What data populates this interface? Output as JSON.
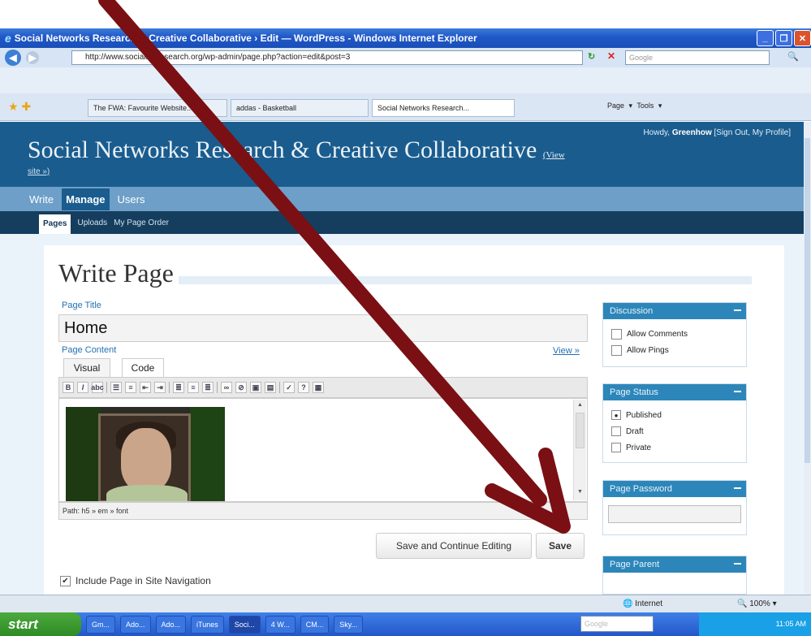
{
  "window": {
    "title": "Social Networks Research & Creative Collaborative › Edit — WordPress - Windows Internet Explorer",
    "url": "http://www.socialnetresearch.org/wp-admin/page.php?action=edit&post=3",
    "search_placeholder": "Google"
  },
  "tabs": [
    {
      "label": "The FWA: Favourite Website..."
    },
    {
      "label": "addas - Basketball"
    },
    {
      "label": "Social Networks Research..."
    }
  ],
  "ie_tools": "Page ▾  Tools ▾",
  "wp": {
    "site_title": "Social Networks Research & Creative Collaborative",
    "view_site_1": "(View",
    "view_site_2": "site »)",
    "howdy_prefix": "Howdy, ",
    "user": "Greenhow",
    "user_links": "[Sign Out, My Profile]",
    "menu": [
      "Write",
      "Manage",
      "Users"
    ],
    "submenu": [
      "Pages",
      "Uploads",
      "My Page Order"
    ]
  },
  "editor": {
    "heading": "Write Page",
    "title_label": "Page Title",
    "title_value": "Home",
    "content_label": "Page Content",
    "view_link": "View »",
    "tab_visual": "Visual",
    "tab_code": "Code",
    "path": "Path: h5 » em » font",
    "btn_continue": "Save and Continue Editing",
    "btn_save": "Save",
    "include_nav": "Include Page in Site Navigation"
  },
  "sidebar": {
    "discussion": {
      "title": "Discussion",
      "options": [
        "Allow Comments",
        "Allow Pings"
      ]
    },
    "status": {
      "title": "Page Status",
      "options": [
        "Published",
        "Draft",
        "Private"
      ],
      "selected": "Published"
    },
    "password": {
      "title": "Page Password"
    },
    "parent": {
      "title": "Page Parent"
    }
  },
  "statusbar": {
    "zone": "Internet",
    "zoom": "100%"
  },
  "taskbar": {
    "start": "start",
    "tasks": [
      "Gm...",
      "Ado...",
      "Ado...",
      "iTunes",
      "Soci...",
      "4 W...",
      "CM...",
      "Sky..."
    ],
    "search_placeholder": "Google",
    "clock": "11:05 AM"
  },
  "colors": {
    "wp_header": "#1a5c8e",
    "arrow": "#7a1014",
    "accent": "#2d86b9"
  }
}
